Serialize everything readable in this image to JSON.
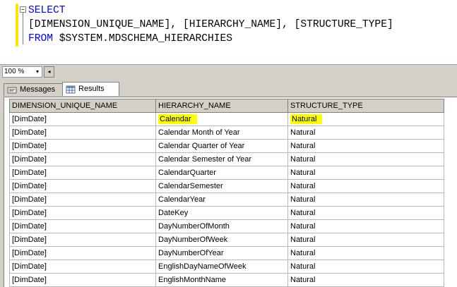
{
  "editor": {
    "lines": [
      [
        {
          "kw": "SELECT"
        }
      ],
      [
        {
          "tx": "[DIMENSION_UNIQUE_NAME], [HIERARCHY_NAME], [STRUCTURE_TYPE]"
        }
      ],
      [
        {
          "kw": "FROM "
        },
        {
          "tx": "$SYSTEM.MDSCHEMA_HIERARCHIES"
        }
      ]
    ],
    "collapse_symbol": "−"
  },
  "zoom": {
    "value": "100 %",
    "dropdown_glyph": "▾",
    "scroll_left_glyph": "◂"
  },
  "tabs": [
    {
      "label": "Messages",
      "icon": "messages-icon"
    },
    {
      "label": "Results",
      "icon": "grid-results-icon"
    }
  ],
  "grid": {
    "columns": [
      "DIMENSION_UNIQUE_NAME",
      "HIERARCHY_NAME",
      "STRUCTURE_TYPE"
    ],
    "rows": [
      [
        "[DimDate]",
        "Calendar",
        "Natural"
      ],
      [
        "[DimDate]",
        "Calendar Month of Year",
        "Natural"
      ],
      [
        "[DimDate]",
        "Calendar Quarter of Year",
        "Natural"
      ],
      [
        "[DimDate]",
        "Calendar Semester of Year",
        "Natural"
      ],
      [
        "[DimDate]",
        "CalendarQuarter",
        "Natural"
      ],
      [
        "[DimDate]",
        "CalendarSemester",
        "Natural"
      ],
      [
        "[DimDate]",
        "CalendarYear",
        "Natural"
      ],
      [
        "[DimDate]",
        "DateKey",
        "Natural"
      ],
      [
        "[DimDate]",
        "DayNumberOfMonth",
        "Natural"
      ],
      [
        "[DimDate]",
        "DayNumberOfWeek",
        "Natural"
      ],
      [
        "[DimDate]",
        "DayNumberOfYear",
        "Natural"
      ],
      [
        "[DimDate]",
        "EnglishDayNameOfWeek",
        "Natural"
      ],
      [
        "[DimDate]",
        "EnglishMonthName",
        "Natural"
      ]
    ],
    "highlighted_row": 0,
    "highlight_color": "#ffff00"
  }
}
